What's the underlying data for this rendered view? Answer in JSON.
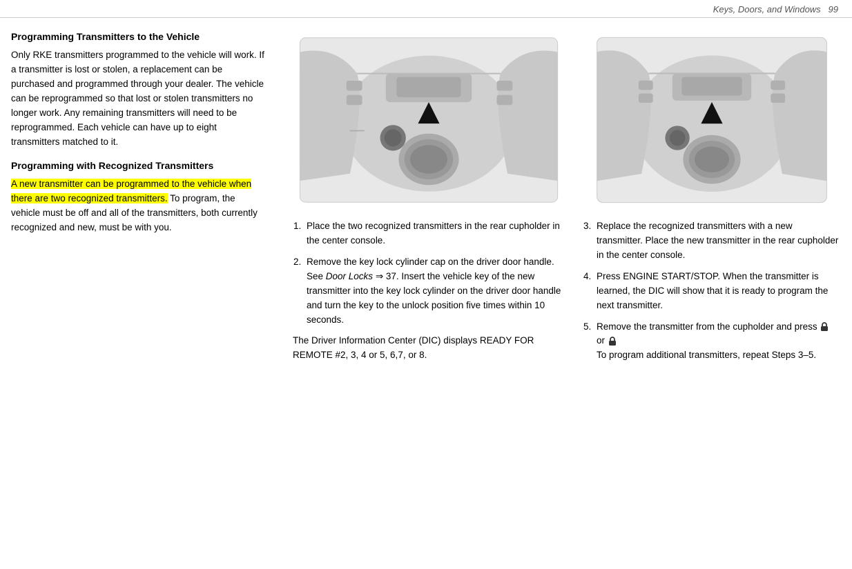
{
  "header": {
    "title": "Keys, Doors, and Windows",
    "page_number": "99"
  },
  "left_column": {
    "section1_title": "Programming Transmitters to the Vehicle",
    "section1_body": "Only RKE transmitters programmed to the vehicle will work. If a transmitter is lost or stolen, a replacement can be purchased and programmed through your dealer. The vehicle can be reprogrammed so that lost or stolen transmitters no longer work. Any remaining transmitters will need to be reprogrammed. Each vehicle can have up to eight transmitters matched to it.",
    "section2_title": "Programming with Recognized Transmitters",
    "section2_highlight": "A new transmitter can be programmed to the vehicle when there are two recognized transmitters.",
    "section2_rest": " To program, the vehicle must be off and all of the transmitters, both currently recognized and new, must be with you."
  },
  "mid_column": {
    "step1": "Place the two recognized transmitters in the rear cupholder in the center console.",
    "step2_start": "Remove the key lock cylinder cap on the driver door handle. See ",
    "step2_italic": "Door Locks",
    "step2_ref": " ⇒ 37.",
    "step2_end": " Insert the vehicle key of the new transmitter into the key lock cylinder on the driver door handle and turn the key to the unlock position five times within 10 seconds.",
    "step2_note": "The Driver Information Center (DIC) displays READY FOR REMOTE #2, 3, 4 or 5, 6,7, or 8."
  },
  "right_column": {
    "step3": "Replace the recognized transmitters with a new transmitter. Place the new transmitter in the rear cupholder in the center console.",
    "step4": "Press ENGINE START/STOP. When the transmitter is learned, the DIC will show that it is ready to program the next transmitter.",
    "step5_start": "Remove the transmitter from the cupholder and press ",
    "step5_end": " or ",
    "step5_note": "To program additional transmitters, repeat Steps 3–5."
  }
}
